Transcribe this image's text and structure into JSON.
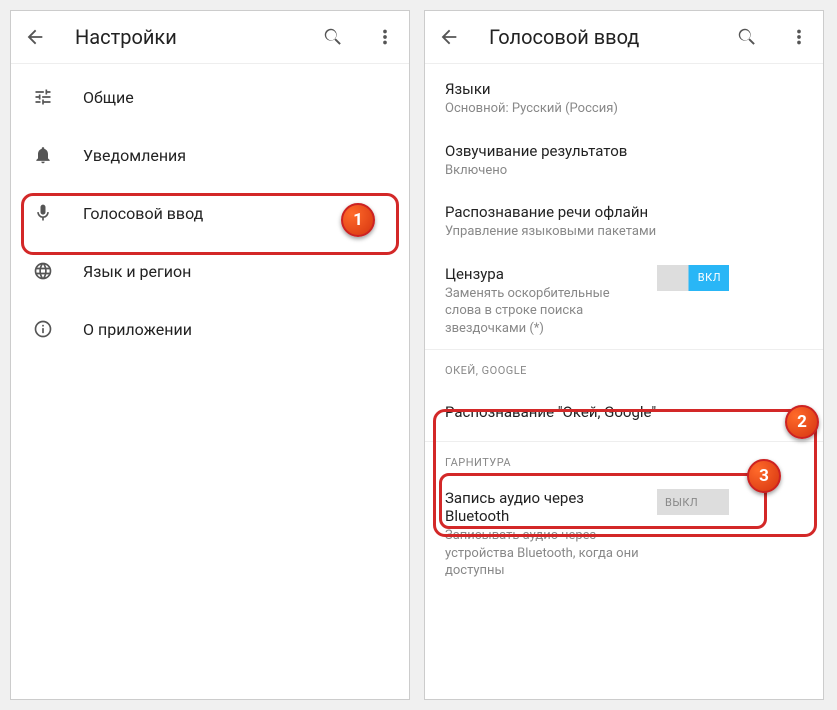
{
  "markers": {
    "m1": "1",
    "m2": "2",
    "m3": "3"
  },
  "left": {
    "title": "Настройки",
    "items": [
      {
        "label": "Общие"
      },
      {
        "label": "Уведомления"
      },
      {
        "label": "Голосовой ввод"
      },
      {
        "label": "Язык и регион"
      },
      {
        "label": "О приложении"
      }
    ]
  },
  "right": {
    "title": "Голосовой ввод",
    "langs": {
      "title": "Языки",
      "sub": "Основной: Русский (Россия)"
    },
    "tts": {
      "title": "Озвучивание результатов",
      "sub": "Включено"
    },
    "offline": {
      "title": "Распознавание речи офлайн",
      "sub": "Управление языковыми пакетами"
    },
    "censor": {
      "title": "Цензура",
      "sub": "Заменять оскорбительные слова в строке поиска звездочками (*)",
      "toggle": "ВКЛ"
    },
    "section_ok": "Окей, Google",
    "ok_recog": {
      "title": "Распознавание \"Окей, Google\""
    },
    "section_headset": "Гарнитура",
    "bt": {
      "title": "Запись аудио через Bluetooth",
      "sub": "Записывать аудио через устройства Bluetooth, когда они доступны",
      "toggle": "ВЫКЛ"
    }
  }
}
